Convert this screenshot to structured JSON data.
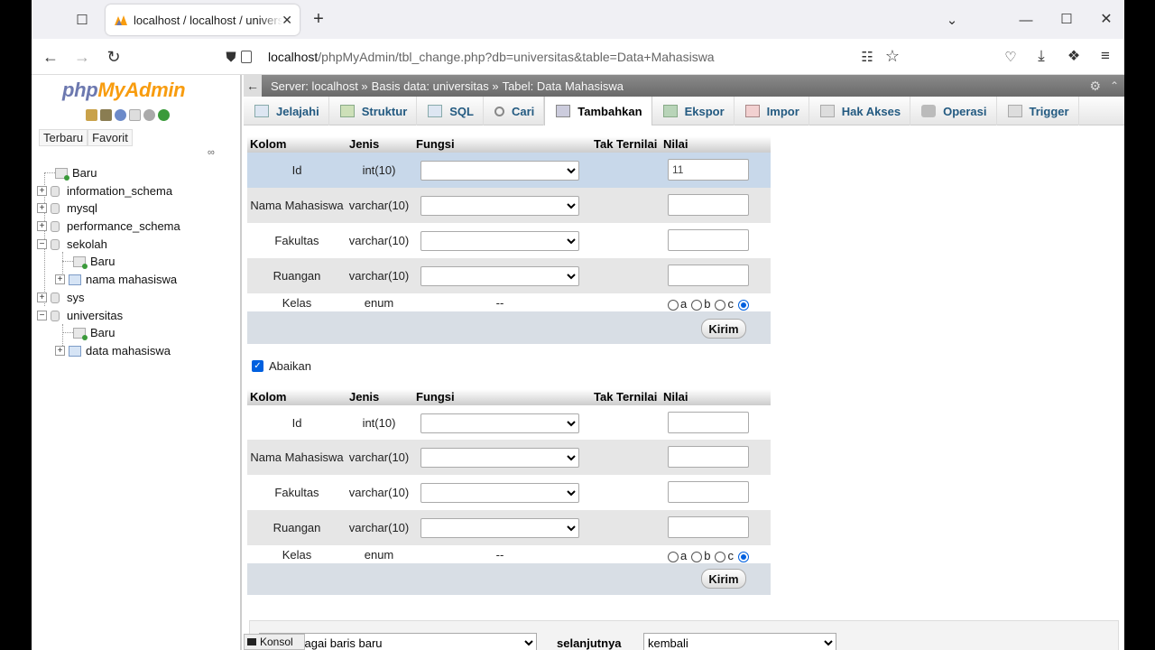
{
  "browser": {
    "tab_title": "localhost / localhost / universitas",
    "url_host": "localhost",
    "url_rest": "/phpMyAdmin/tbl_change.php?db=universitas&table=Data+Mahasiswa"
  },
  "sidebar": {
    "logo_php": "php",
    "logo_ma": "MyAdmin",
    "recent": "Terbaru",
    "favorites": "Favorit",
    "tree": [
      {
        "label": "Baru"
      },
      {
        "label": "information_schema"
      },
      {
        "label": "mysql"
      },
      {
        "label": "performance_schema"
      },
      {
        "label": "sekolah"
      },
      {
        "label": "Baru"
      },
      {
        "label": "nama mahasiswa"
      },
      {
        "label": "sys"
      },
      {
        "label": "universitas"
      },
      {
        "label": "Baru"
      },
      {
        "label": "data mahasiswa"
      }
    ]
  },
  "breadcrumb": {
    "server": "Server: localhost »",
    "db": "Basis data: universitas »",
    "table": "Tabel: Data Mahasiswa"
  },
  "menu": [
    "Jelajahi",
    "Struktur",
    "SQL",
    "Cari",
    "Tambahkan",
    "Ekspor",
    "Impor",
    "Hak Akses",
    "Operasi",
    "Trigger"
  ],
  "headers": {
    "col": "Kolom",
    "type": "Jenis",
    "func": "Fungsi",
    "null": "Tak Ternilai",
    "value": "Nilai"
  },
  "rows": [
    {
      "name": "Id",
      "type": "int(10)"
    },
    {
      "name": "Nama Mahasiswa",
      "type": "varchar(10)"
    },
    {
      "name": "Fakultas",
      "type": "varchar(10)"
    },
    {
      "name": "Ruangan",
      "type": "varchar(10)"
    },
    {
      "name": "Kelas",
      "type": "enum",
      "func": "--"
    }
  ],
  "form1": {
    "id_value": "11"
  },
  "enum_options": [
    "a",
    "b",
    "c"
  ],
  "submit_label": "Kirim",
  "ignore_label": "Abaikan",
  "footer": {
    "insert_select": "kan sebagai baris baru",
    "next_label": "selanjutnya",
    "next_select": "kembali"
  },
  "console_label": "Konsol"
}
